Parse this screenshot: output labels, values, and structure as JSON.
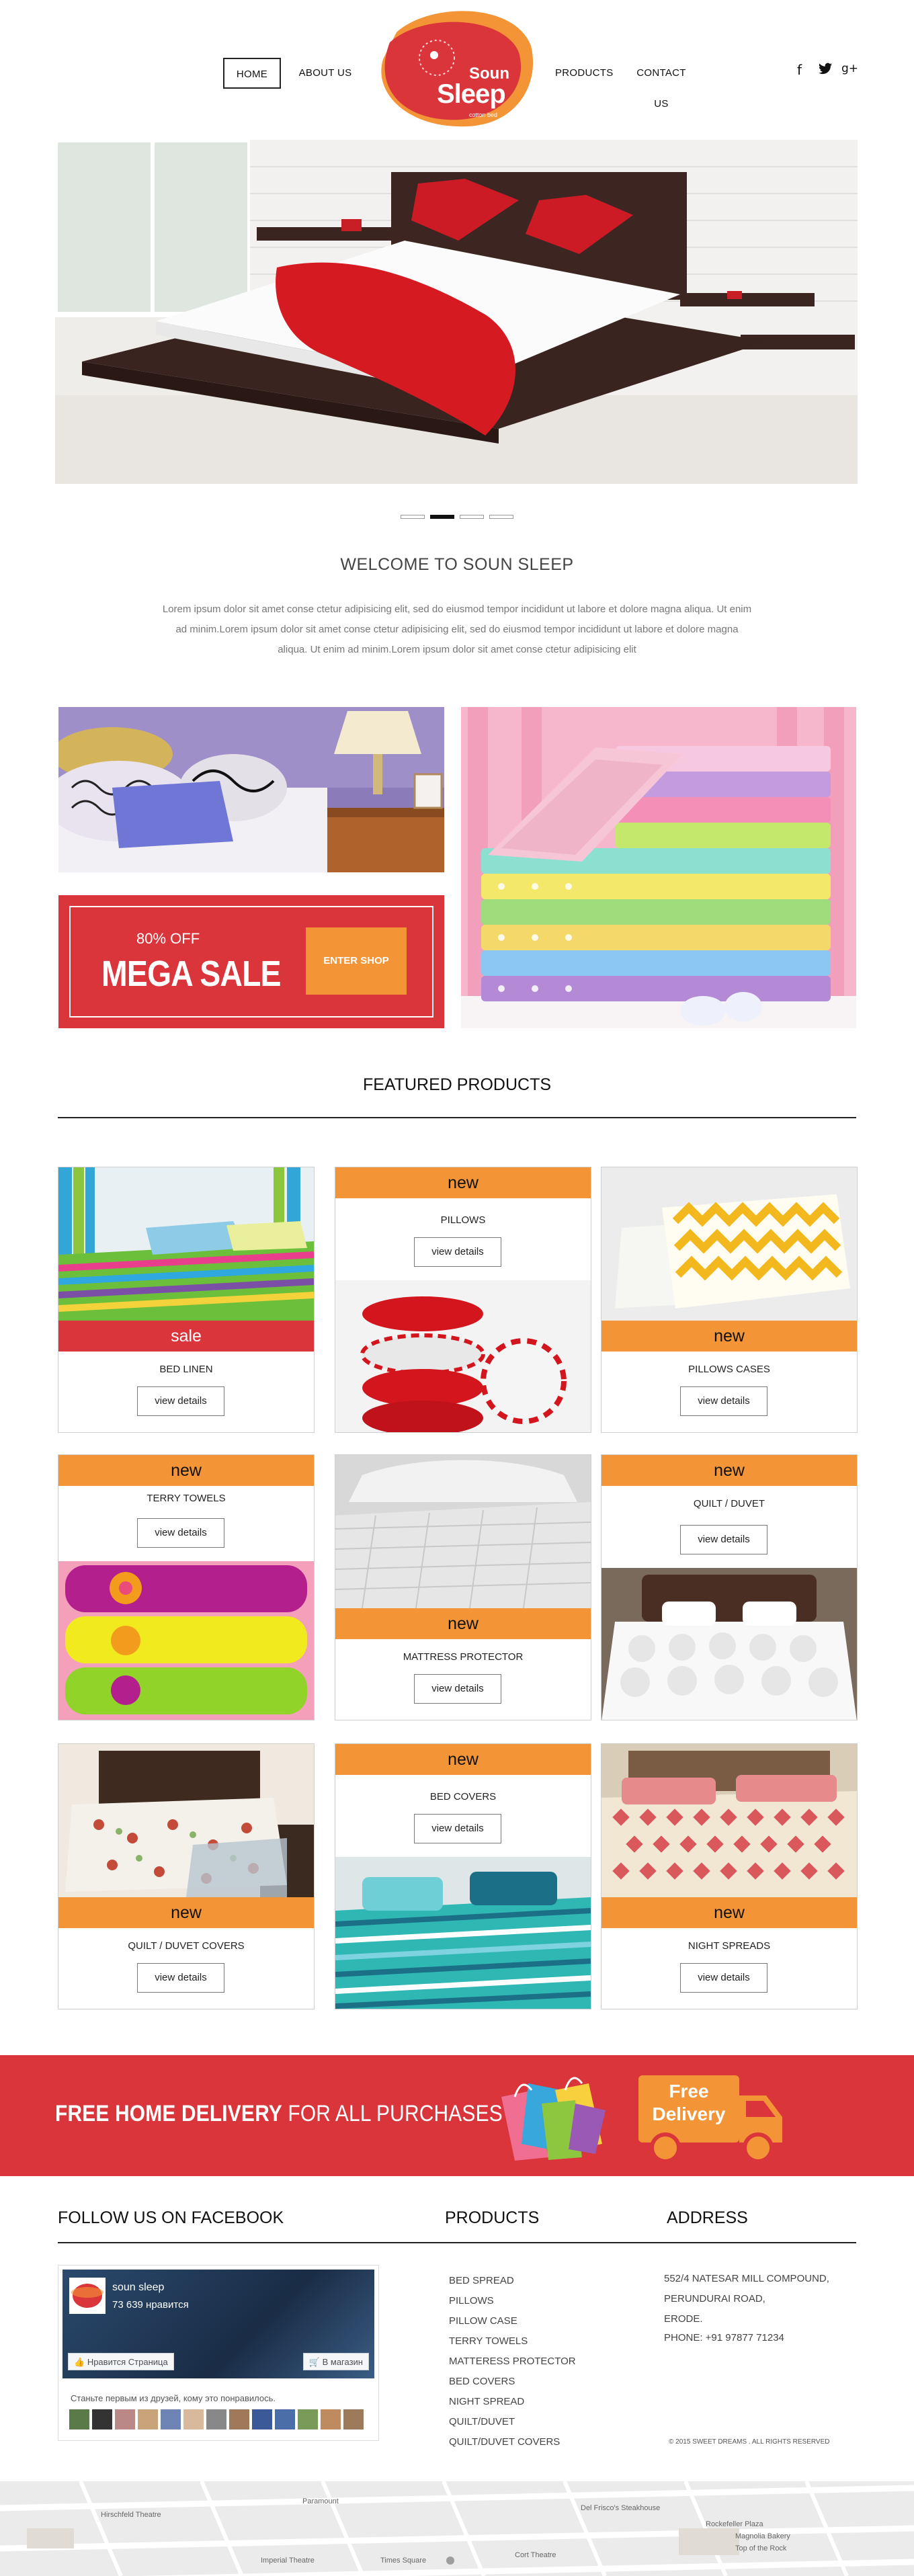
{
  "header": {
    "nav_left": [
      "HOME",
      "ABOUT US"
    ],
    "nav_right": [
      "PRODUCTS",
      "CONTACT US"
    ],
    "logo_top": "Soun",
    "logo_bottom": "Sleep",
    "logo_tagline": "cotton bed",
    "social": [
      "f",
      "t",
      "g+"
    ]
  },
  "welcome": {
    "title": "WELCOME TO SOUN SLEEP",
    "text": "Lorem ipsum dolor sit amet conse ctetur adipisicing elit, sed do eiusmod tempor incididunt ut labore et dolore magna aliqua. Ut enim ad minim.Lorem ipsum dolor sit amet conse ctetur adipisicing elit, sed do eiusmod tempor incididunt ut labore et dolore magna aliqua. Ut enim ad minim.Lorem ipsum dolor sit amet conse ctetur adipisicing elit"
  },
  "promo": {
    "off": "80% OFF",
    "title": "MEGA SALE",
    "button": "ENTER SHOP"
  },
  "featured": {
    "title": "FEATURED PRODUCTS",
    "products": [
      {
        "name": "BED LINEN",
        "badge": "sale",
        "button": "view details"
      },
      {
        "name": "PILLOWS",
        "badge": "new",
        "button": "view details"
      },
      {
        "name": "PILLOWS CASES",
        "badge": "new",
        "button": "view details"
      },
      {
        "name": "TERRY  TOWELS",
        "badge": "new",
        "button": "view details"
      },
      {
        "name": "MATTRESS PROTECTOR",
        "badge": "new",
        "button": "view details"
      },
      {
        "name": "QUILT / DUVET",
        "badge": "new",
        "button": "view details"
      },
      {
        "name": "QUILT / DUVET COVERS",
        "badge": "new",
        "button": "view details"
      },
      {
        "name": "BED COVERS",
        "badge": "new",
        "button": "view details"
      },
      {
        "name": "NIGHT SPREADS",
        "badge": "new",
        "button": "view details"
      }
    ]
  },
  "delivery": {
    "bold": "FREE HOME DELIVERY",
    "rest": " FOR ALL PURCHASES",
    "truck_line1": "Free",
    "truck_line2": "Delivery"
  },
  "footer": {
    "facebook_heading": "FOLLOW US ON FACEBOOK",
    "products_heading": "PRODUCTS",
    "address_heading": "ADDRESS",
    "fb": {
      "page_name": "soun sleep",
      "likes": "73 639 нравится",
      "like_button": "Нравится Страница",
      "shop_button": "В магазин",
      "friends_text": "Станьте первым из друзей, кому это понравилось."
    },
    "product_links": [
      "BED SPREAD",
      "PILLOWS",
      "PILLOW CASE",
      "TERRY TOWELS",
      "MATTERESS PROTECTOR",
      "BED COVERS",
      "NIGHT SPREAD",
      "QUILT/DUVET",
      "QUILT/DUVET COVERS"
    ],
    "address_lines": [
      "552/4 NATESAR MILL COMPOUND,",
      "PERUNDURAI ROAD,",
      "ERODE.",
      "PHONE: +91 97877 71234"
    ],
    "copyright": "© 2015 SWEET DREAMS . ALL RIGHTS RESERVED"
  },
  "map": {
    "labels": [
      "Hirschfeld Theatre",
      "Paramount",
      "Imperial Theatre",
      "Times Square",
      "Cort Theatre",
      "Del Frisco's Steakhouse",
      "Rockefeller Plaza",
      "Magnolia Bakery",
      "Top of the Rock"
    ]
  },
  "colors": {
    "brand_red": "#d9353b",
    "accent_orange": "#f39436"
  }
}
